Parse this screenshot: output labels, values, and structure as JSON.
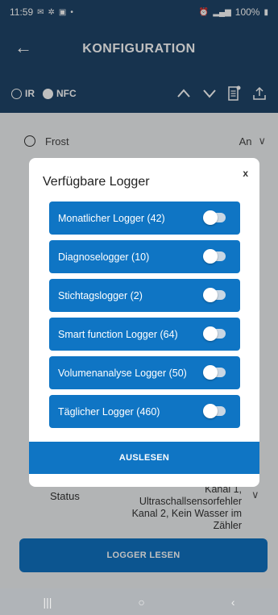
{
  "status_bar": {
    "time": "11:59",
    "battery": "100%"
  },
  "app_bar": {
    "title": "KONFIGURATION"
  },
  "mode_bar": {
    "ir_label": "IR",
    "nfc_label": "NFC",
    "selected": "NFC"
  },
  "background": {
    "rows": [
      {
        "label": "Frost",
        "value": "An"
      }
    ],
    "status_label": "Status",
    "status_text": "Kanal 1, Ultraschallsensorfehler Kanal 2, Kein Wasser im Zähler",
    "logger_read_button": "LOGGER LESEN"
  },
  "dialog": {
    "title": "Verfügbare Logger",
    "close_label": "x",
    "loggers": [
      {
        "label": "Monatlicher Logger (42)",
        "enabled": false
      },
      {
        "label": "Diagnoselogger (10)",
        "enabled": false
      },
      {
        "label": "Stichtagslogger (2)",
        "enabled": false
      },
      {
        "label": "Smart function Logger (64)",
        "enabled": false
      },
      {
        "label": "Volumenanalyse Logger (50)",
        "enabled": false
      },
      {
        "label": "Täglicher Logger (460)",
        "enabled": false
      }
    ],
    "read_out_button": "AUSLESEN"
  },
  "icons": {
    "back": "arrow-left-icon",
    "up": "chevron-up-icon",
    "down": "chevron-down-icon",
    "document": "document-icon",
    "upload": "upload-icon"
  },
  "colors": {
    "app_bar": "#1f4568",
    "accent": "#0f75c4"
  }
}
